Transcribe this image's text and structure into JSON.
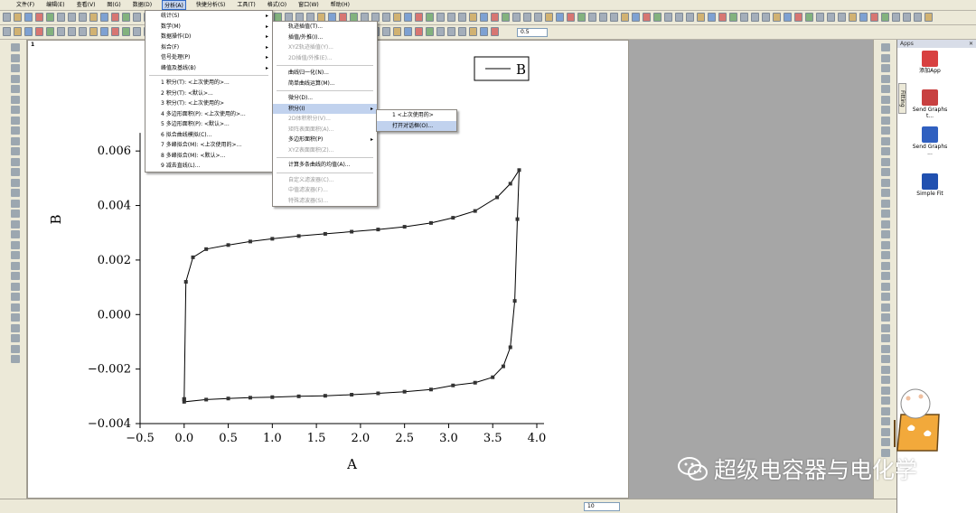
{
  "menubar": {
    "items": [
      "文件(F)",
      "编辑(E)",
      "查看(V)",
      "图(G)",
      "数据(D)",
      "分析(A)",
      "快捷分析(S)",
      "工具(T)",
      "格式(O)",
      "窗口(W)",
      "帮助(H)"
    ]
  },
  "toolbar2": {
    "line_width": "0.5"
  },
  "graph_window": {
    "tab_number": "1"
  },
  "analysis_menu": {
    "items": [
      {
        "label": "统计(S)",
        "arrow": "▸"
      },
      {
        "label": "数学(M)",
        "arrow": "▸"
      },
      {
        "label": "数据操作(D)",
        "arrow": "▸"
      },
      {
        "label": "拟合(F)",
        "arrow": "▸"
      },
      {
        "label": "信号处理(P)",
        "arrow": "▸"
      },
      {
        "label": "峰值及基线(B)",
        "arrow": "▸"
      },
      {
        "label": "1 积分(T): <上次使用的>...",
        "arrow": ""
      },
      {
        "label": "2 积分(T): <默认>...",
        "arrow": ""
      },
      {
        "label": "3 积分(T): <上次使用的>",
        "arrow": ""
      },
      {
        "label": "4 多边形面积(P): <上次使用的>...",
        "arrow": ""
      },
      {
        "label": "5 多边形面积(P): <默认>...",
        "arrow": ""
      },
      {
        "label": "6 拟合曲线模拟(C)...",
        "arrow": ""
      },
      {
        "label": "7 多峰拟合(M): <上次使用的>...",
        "arrow": ""
      },
      {
        "label": "8 多峰拟合(M): <默认>...",
        "arrow": ""
      },
      {
        "label": "9 减去直线(L)...",
        "arrow": ""
      }
    ]
  },
  "math_menu": {
    "items": [
      {
        "label": "轨迹插值(T)...",
        "disabled": false,
        "arrow": ""
      },
      {
        "label": "插值/外推(I)...",
        "disabled": false,
        "arrow": ""
      },
      {
        "label": "XYZ轨迹插值(Y)...",
        "disabled": true,
        "arrow": ""
      },
      {
        "label": "2D插值/外推(E)...",
        "disabled": true,
        "arrow": ""
      },
      {
        "label": "曲线归一化(N)...",
        "disabled": false,
        "arrow": ""
      },
      {
        "label": "简单曲线运算(M)...",
        "disabled": false,
        "arrow": ""
      },
      {
        "label": "微分(D)...",
        "disabled": false,
        "arrow": ""
      },
      {
        "label": "积分(I)",
        "disabled": false,
        "arrow": "▸",
        "highlight": true
      },
      {
        "label": "2D体积积分(V)...",
        "disabled": true,
        "arrow": ""
      },
      {
        "label": "矩阵表面面积(A)...",
        "disabled": true,
        "arrow": ""
      },
      {
        "label": "多边形面积(P)",
        "disabled": false,
        "arrow": "▸"
      },
      {
        "label": "XYZ表面面积(Z)...",
        "disabled": true,
        "arrow": ""
      },
      {
        "label": "计算多条曲线的均值(A)...",
        "disabled": false,
        "arrow": ""
      },
      {
        "label": "自定义滤波器(C)...",
        "disabled": true,
        "arrow": ""
      },
      {
        "label": "中值滤波器(F)...",
        "disabled": true,
        "arrow": ""
      },
      {
        "label": "特殊滤波器(S)...",
        "disabled": true,
        "arrow": ""
      }
    ]
  },
  "integrate_menu": {
    "items": [
      {
        "label": "1 <上次使用的>",
        "highlight": false
      },
      {
        "label": "打开对话框(O)...",
        "highlight": true
      }
    ]
  },
  "apps_panel": {
    "title": "Apps",
    "close": "✕",
    "tab_label": "Fitting",
    "items": [
      {
        "label": "添加App",
        "icon": "add-app-icon",
        "color": "#d84040"
      },
      {
        "label": "Send Graphs t...",
        "icon": "send-graphs-icon",
        "color": "#c84040"
      },
      {
        "label": "Send Graphs ...",
        "icon": "send-graphs-2-icon",
        "color": "#3060c0"
      },
      {
        "label": "Simple Fit",
        "icon": "simple-fit-icon",
        "color": "#2050b0"
      }
    ]
  },
  "status_zoom": "10",
  "watermark": "超级电容器与电化学",
  "colors": {
    "menu_highlight": "#c1d2ee",
    "workspace_bg": "#a6a6a6",
    "toolbar_bg": "#ece9d8"
  },
  "chart_data": {
    "type": "line",
    "xlabel": "A",
    "ylabel": "B",
    "xlim": [
      -0.5,
      4.0
    ],
    "ylim": [
      -0.004,
      0.007
    ],
    "xticks": [
      "−0.5",
      "0.0",
      "0.5",
      "1.0",
      "1.5",
      "2.0",
      "2.5",
      "3.0",
      "3.5",
      "4.0"
    ],
    "yticks": [
      "−0.004",
      "−0.002",
      "0.000",
      "0.002",
      "0.004",
      "0.006"
    ],
    "xtick_values": [
      -0.5,
      0.0,
      0.5,
      1.0,
      1.5,
      2.0,
      2.5,
      3.0,
      3.5,
      4.0
    ],
    "ytick_values": [
      -0.004,
      -0.002,
      0.0,
      0.002,
      0.004,
      0.006
    ],
    "legend": "B",
    "grid": false,
    "series": [
      {
        "name": "B",
        "upper": [
          [
            0.0,
            -0.0031
          ],
          [
            0.02,
            0.0012
          ],
          [
            0.1,
            0.0021
          ],
          [
            0.25,
            0.0024
          ],
          [
            0.5,
            0.00255
          ],
          [
            0.75,
            0.00268
          ],
          [
            1.0,
            0.00278
          ],
          [
            1.3,
            0.00288
          ],
          [
            1.6,
            0.00296
          ],
          [
            1.9,
            0.00304
          ],
          [
            2.2,
            0.00312
          ],
          [
            2.5,
            0.00322
          ],
          [
            2.8,
            0.00336
          ],
          [
            3.05,
            0.00355
          ],
          [
            3.3,
            0.0038
          ],
          [
            3.55,
            0.0043
          ],
          [
            3.7,
            0.0048
          ],
          [
            3.8,
            0.0053
          ]
        ],
        "lower": [
          [
            3.8,
            0.0053
          ],
          [
            3.78,
            0.0035
          ],
          [
            3.75,
            0.0005
          ],
          [
            3.7,
            -0.0012
          ],
          [
            3.62,
            -0.0019
          ],
          [
            3.5,
            -0.0023
          ],
          [
            3.3,
            -0.0025
          ],
          [
            3.05,
            -0.0026
          ],
          [
            2.8,
            -0.00275
          ],
          [
            2.5,
            -0.00283
          ],
          [
            2.2,
            -0.00289
          ],
          [
            1.9,
            -0.00294
          ],
          [
            1.6,
            -0.00298
          ],
          [
            1.3,
            -0.003
          ],
          [
            1.0,
            -0.00303
          ],
          [
            0.75,
            -0.00305
          ],
          [
            0.5,
            -0.00308
          ],
          [
            0.25,
            -0.00312
          ],
          [
            0.0,
            -0.0032
          ],
          [
            0.0,
            -0.0031
          ]
        ]
      }
    ]
  }
}
